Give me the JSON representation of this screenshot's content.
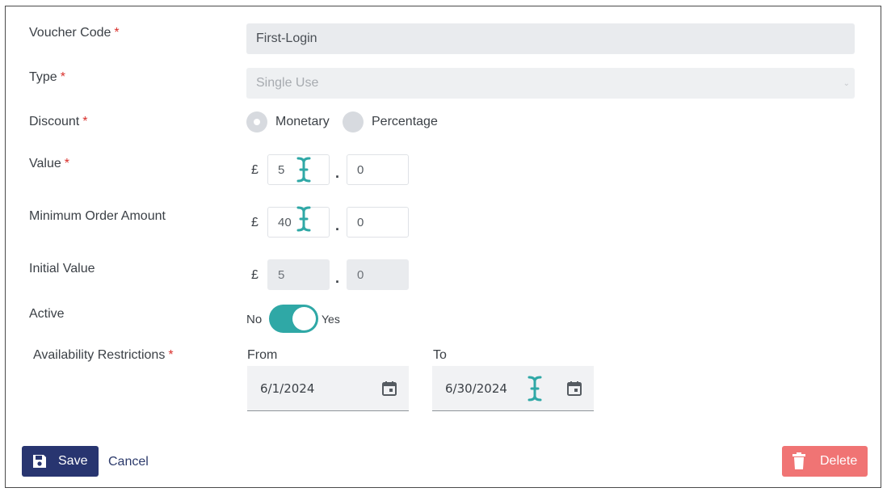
{
  "form": {
    "voucher_code": {
      "label": "Voucher Code",
      "required": "*",
      "value": "First-Login"
    },
    "type": {
      "label": "Type",
      "required": "*",
      "value": "Single Use"
    },
    "discount": {
      "label": "Discount",
      "required": "*",
      "options": [
        "Monetary",
        "Percentage"
      ],
      "selected": "Monetary"
    },
    "value": {
      "label": "Value",
      "required": "*",
      "currency": "£",
      "whole": "5",
      "separator": ".",
      "fraction": "0"
    },
    "minimum_order": {
      "label": "Minimum Order Amount",
      "currency": "£",
      "whole": "40",
      "separator": ".",
      "fraction": "0"
    },
    "initial_value": {
      "label": "Initial Value",
      "currency": "£",
      "whole": "5",
      "separator": ".",
      "fraction": "0"
    },
    "active": {
      "label": "Active",
      "off_label": "No",
      "on_label": "Yes",
      "state": "on"
    },
    "availability": {
      "label": "Availability Restrictions",
      "required": "*",
      "from_label": "From",
      "from_value": "6/1/2024",
      "to_label": "To",
      "to_value": "6/30/2024"
    }
  },
  "actions": {
    "save_label": "Save",
    "cancel_label": "Cancel",
    "delete_label": "Delete"
  },
  "icons": {
    "save": "floppy-disk-icon",
    "delete": "trash-icon",
    "calendar": "calendar-icon",
    "cursor": "text-cursor-icon"
  },
  "colors": {
    "primary": "#283570",
    "accent": "#2fa8a6",
    "danger": "#f07474",
    "required": "#d9302c"
  }
}
